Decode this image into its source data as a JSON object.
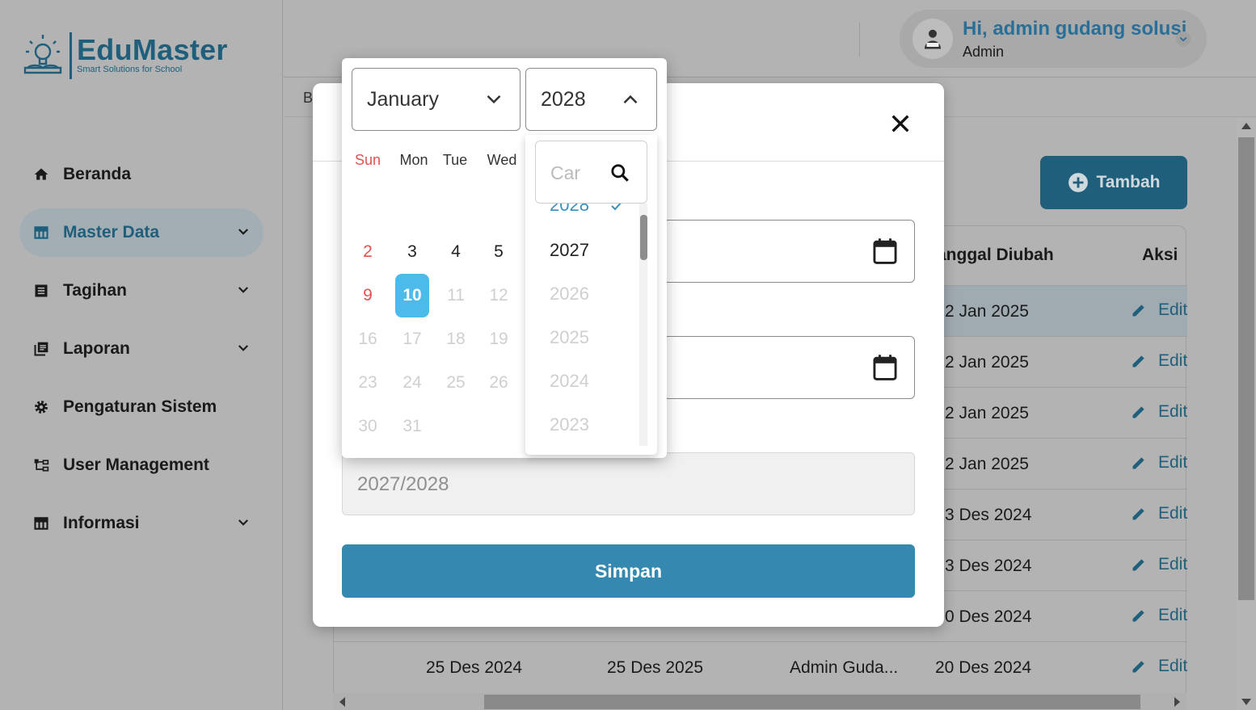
{
  "app": {
    "logo_name": "EduMaster",
    "logo_tagline": "Smart Solutions for School"
  },
  "sidebar": {
    "items": [
      {
        "label": "Beranda",
        "icon": "home-icon",
        "expandable": false,
        "active": false
      },
      {
        "label": "Master Data",
        "icon": "table-icon",
        "expandable": true,
        "active": true
      },
      {
        "label": "Tagihan",
        "icon": "list-icon",
        "expandable": true,
        "active": false
      },
      {
        "label": "Laporan",
        "icon": "library-icon",
        "expandable": true,
        "active": false
      },
      {
        "label": "Pengaturan Sistem",
        "icon": "gear-icon",
        "expandable": false,
        "active": false
      },
      {
        "label": "User Management",
        "icon": "hierarchy-icon",
        "expandable": false,
        "active": false
      },
      {
        "label": "Informasi",
        "icon": "table-icon",
        "expandable": true,
        "active": false
      }
    ]
  },
  "header": {
    "greeting": "Hi, admin gudang solusi",
    "role": "Admin"
  },
  "breadcrumb": {
    "partial": "B"
  },
  "content": {
    "add_button": "Tambah",
    "columns": {
      "modified": "anggal Diubah",
      "action": "Aksi"
    },
    "rows": [
      {
        "start": "",
        "end": "",
        "by": "",
        "modified": "2 Jan 2025"
      },
      {
        "start": "",
        "end": "",
        "by": "",
        "modified": "2 Jan 2025"
      },
      {
        "start": "",
        "end": "",
        "by": "",
        "modified": "2 Jan 2025"
      },
      {
        "start": "",
        "end": "",
        "by": "",
        "modified": "2 Jan 2025"
      },
      {
        "start": "",
        "end": "",
        "by": "",
        "modified": "3 Des 2024"
      },
      {
        "start": "",
        "end": "",
        "by": "",
        "modified": "3 Des 2024"
      },
      {
        "start": "",
        "end": "",
        "by": "",
        "modified": "0 Des 2024"
      },
      {
        "start": "25 Des 2024",
        "end": "25 Des 2025",
        "by": "Admin Guda...",
        "modified": "20 Des 2024"
      }
    ],
    "edit_label": "Edit"
  },
  "modal": {
    "academic_year_value": "2027/2028",
    "save_button": "Simpan"
  },
  "datepicker": {
    "month": "January",
    "year": "2028",
    "weekdays": [
      "Sun",
      "Mon",
      "Tue",
      "Wed"
    ],
    "days": [
      {
        "label": "2",
        "state": "sun"
      },
      {
        "label": "3",
        "state": "norm"
      },
      {
        "label": "4",
        "state": "norm"
      },
      {
        "label": "5",
        "state": "norm"
      },
      {
        "label": "9",
        "state": "sun"
      },
      {
        "label": "10",
        "state": "selected"
      },
      {
        "label": "11",
        "state": "dis"
      },
      {
        "label": "12",
        "state": "dis"
      },
      {
        "label": "16",
        "state": "dis"
      },
      {
        "label": "17",
        "state": "dis"
      },
      {
        "label": "18",
        "state": "dis"
      },
      {
        "label": "19",
        "state": "dis"
      },
      {
        "label": "23",
        "state": "dis"
      },
      {
        "label": "24",
        "state": "dis"
      },
      {
        "label": "25",
        "state": "dis"
      },
      {
        "label": "26",
        "state": "dis"
      },
      {
        "label": "30",
        "state": "dis"
      },
      {
        "label": "31",
        "state": "dis"
      }
    ],
    "year_search_placeholder": "Car",
    "years": [
      {
        "label": "2028",
        "state": "selected"
      },
      {
        "label": "2027",
        "state": "enabled"
      },
      {
        "label": "2026",
        "state": "disabled"
      },
      {
        "label": "2025",
        "state": "disabled"
      },
      {
        "label": "2024",
        "state": "disabled"
      },
      {
        "label": "2023",
        "state": "disabled"
      }
    ]
  }
}
